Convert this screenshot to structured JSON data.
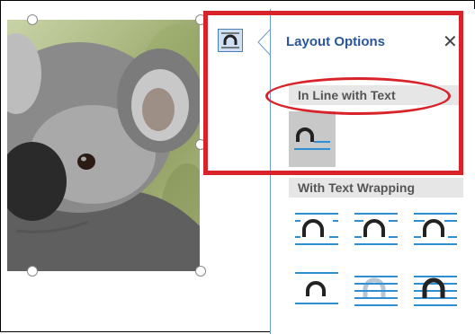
{
  "panel": {
    "title": "Layout Options",
    "close_icon": "close-icon",
    "sections": {
      "inline": "In Line with Text",
      "wrapping": "With Text Wrapping"
    }
  },
  "colors": {
    "accent": "#2b579a",
    "highlight": "#d8232a",
    "icon_blue": "#2f8fd3"
  },
  "icons": {
    "anchor": "layout-options-icon",
    "inline": "inline-with-text-icon",
    "wrap": [
      "square-wrap-icon",
      "tight-wrap-icon",
      "through-wrap-icon",
      "top-bottom-wrap-icon",
      "behind-text-icon",
      "in-front-of-text-icon"
    ]
  }
}
